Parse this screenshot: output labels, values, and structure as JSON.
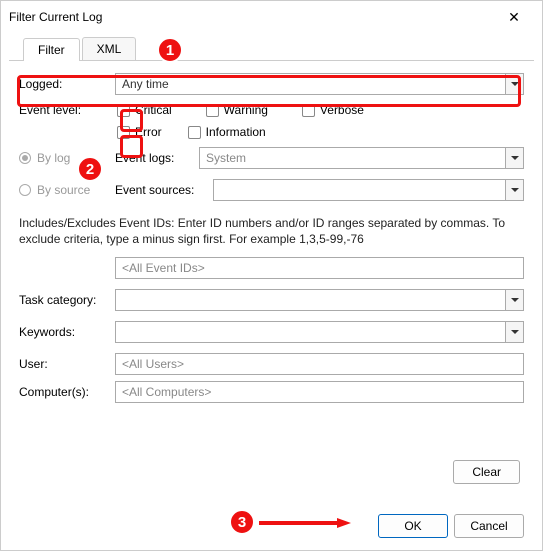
{
  "window": {
    "title": "Filter Current Log"
  },
  "tabs": {
    "filter": "Filter",
    "xml": "XML"
  },
  "labels": {
    "logged": "Logged:",
    "event_level": "Event level:",
    "by_log": "By log",
    "by_source": "By source",
    "event_logs": "Event logs:",
    "event_sources": "Event sources:",
    "task_category": "Task category:",
    "keywords": "Keywords:",
    "user": "User:",
    "computers": "Computer(s):"
  },
  "logged": {
    "value": "Any time"
  },
  "event_level": {
    "critical": "Critical",
    "warning": "Warning",
    "verbose": "Verbose",
    "error": "Error",
    "information": "Information"
  },
  "event_logs": {
    "value": "System"
  },
  "help_text": "Includes/Excludes Event IDs: Enter ID numbers and/or ID ranges separated by commas. To exclude criteria, type a minus sign first. For example 1,3,5-99,-76",
  "event_ids": {
    "placeholder": "<All Event IDs>"
  },
  "user": {
    "placeholder": "<All Users>"
  },
  "computers": {
    "placeholder": "<All Computers>"
  },
  "buttons": {
    "clear": "Clear",
    "ok": "OK",
    "cancel": "Cancel"
  },
  "badges": {
    "b1": "1",
    "b2": "2",
    "b3": "3"
  },
  "accent_red": "#e11"
}
